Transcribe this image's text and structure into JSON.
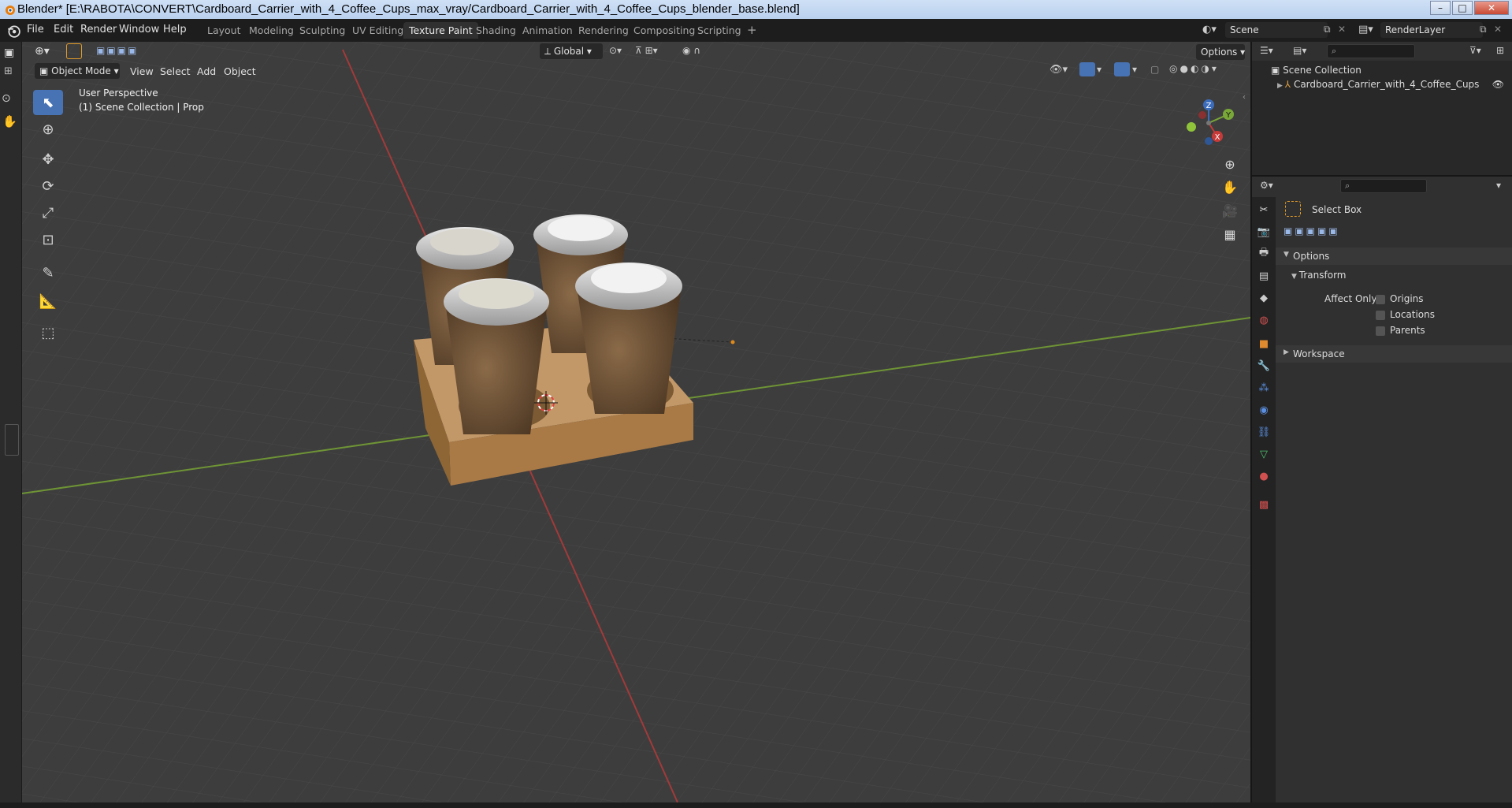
{
  "window": {
    "title": "Blender* [E:\\RABOTA\\CONVERT\\Cardboard_Carrier_with_4_Coffee_Cups_max_vray/Cardboard_Carrier_with_4_Coffee_Cups_blender_base.blend]",
    "controls": [
      "–",
      "□",
      "✕"
    ]
  },
  "menu": [
    "File",
    "Edit",
    "Render",
    "Window",
    "Help"
  ],
  "workspaces": [
    "Layout",
    "Modeling",
    "Sculpting",
    "UV Editing",
    "Texture Paint",
    "Shading",
    "Animation",
    "Rendering",
    "Compositing",
    "Scripting"
  ],
  "active_workspace": "Texture Paint",
  "scene": {
    "scene_name": "Scene",
    "render_layer": "RenderLayer"
  },
  "viewport_header": {
    "mode": "Object Mode",
    "menus": [
      "View",
      "Select",
      "Add",
      "Object"
    ],
    "transform_orientation": "Global",
    "options_label": "Options"
  },
  "viewport_info": {
    "line1": "User Perspective",
    "line2": "(1) Scene Collection | Prop"
  },
  "gizmo_axes": {
    "x": "X",
    "y": "Y",
    "z": "Z"
  },
  "outliner": {
    "root": "Scene Collection",
    "items": [
      "Cardboard_Carrier_with_4_Coffee_Cups"
    ]
  },
  "properties": {
    "tool_name": "Select Box",
    "options_header": "Options",
    "transform_header": "Transform",
    "affect_only_label": "Affect Only",
    "checkboxes": [
      "Origins",
      "Locations",
      "Parents"
    ],
    "workspace_header": "Workspace"
  },
  "colors": {
    "accent": "#4772b3",
    "x_axis": "#c73a3a",
    "y_axis": "#7aa838",
    "viewport_bg": "#3d3d3d",
    "cardboard": "#b98e5a"
  }
}
